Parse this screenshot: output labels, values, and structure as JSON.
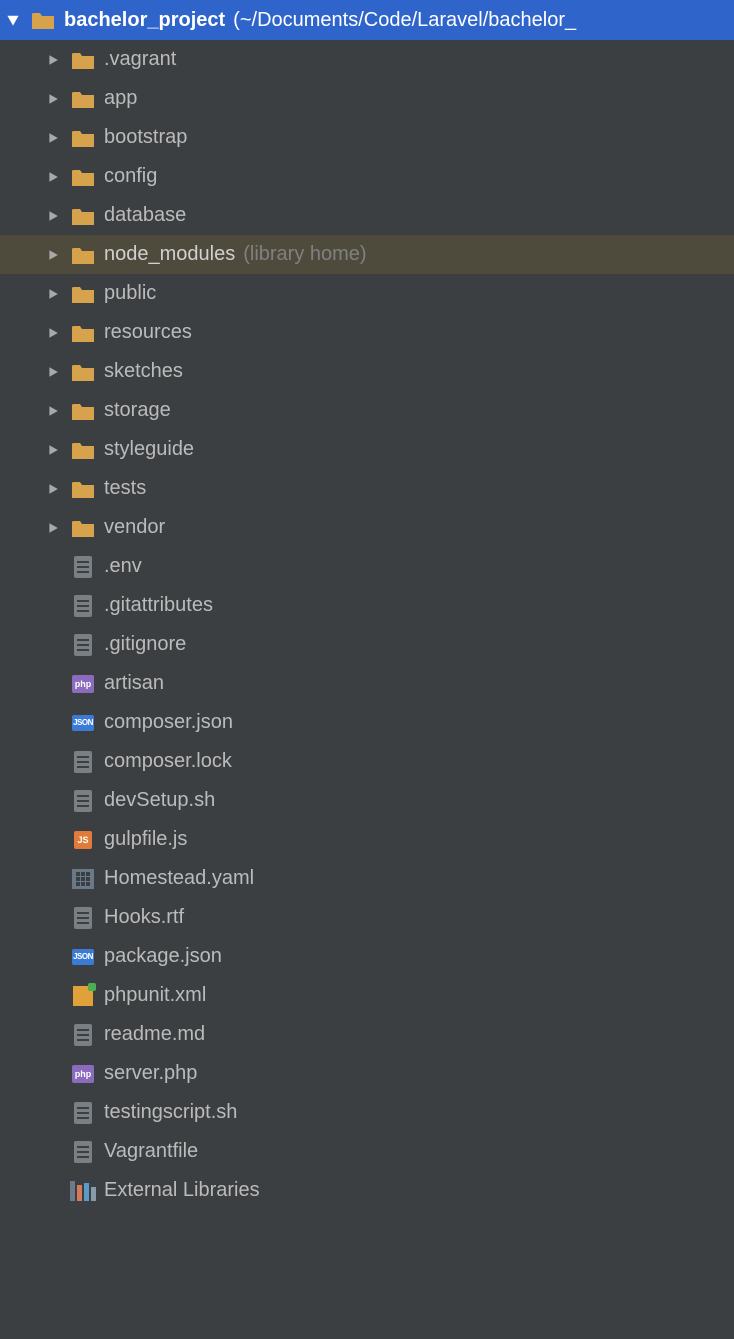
{
  "root": {
    "name": "bachelor_project",
    "path": "(~/Documents/Code/Laravel/bachelor_"
  },
  "items": [
    {
      "type": "folder",
      "name": ".vagrant"
    },
    {
      "type": "folder",
      "name": "app"
    },
    {
      "type": "folder",
      "name": "bootstrap"
    },
    {
      "type": "folder",
      "name": "config"
    },
    {
      "type": "folder",
      "name": "database"
    },
    {
      "type": "folder",
      "name": "node_modules",
      "note": "(library home)",
      "highlighted": true
    },
    {
      "type": "folder",
      "name": "public"
    },
    {
      "type": "folder",
      "name": "resources"
    },
    {
      "type": "folder",
      "name": "sketches"
    },
    {
      "type": "folder",
      "name": "storage"
    },
    {
      "type": "folder",
      "name": "styleguide"
    },
    {
      "type": "folder",
      "name": "tests"
    },
    {
      "type": "folder",
      "name": "vendor"
    },
    {
      "type": "file",
      "icon": "generic",
      "name": ".env"
    },
    {
      "type": "file",
      "icon": "generic",
      "name": ".gitattributes"
    },
    {
      "type": "file",
      "icon": "generic",
      "name": ".gitignore"
    },
    {
      "type": "file",
      "icon": "php",
      "name": "artisan"
    },
    {
      "type": "file",
      "icon": "json",
      "name": "composer.json"
    },
    {
      "type": "file",
      "icon": "generic",
      "name": "composer.lock"
    },
    {
      "type": "file",
      "icon": "generic",
      "name": "devSetup.sh"
    },
    {
      "type": "file",
      "icon": "js",
      "name": "gulpfile.js"
    },
    {
      "type": "file",
      "icon": "yaml",
      "name": "Homestead.yaml"
    },
    {
      "type": "file",
      "icon": "generic",
      "name": "Hooks.rtf"
    },
    {
      "type": "file",
      "icon": "json",
      "name": "package.json"
    },
    {
      "type": "file",
      "icon": "xml",
      "name": "phpunit.xml"
    },
    {
      "type": "file",
      "icon": "generic",
      "name": "readme.md"
    },
    {
      "type": "file",
      "icon": "php",
      "name": "server.php"
    },
    {
      "type": "file",
      "icon": "generic",
      "name": "testingscript.sh"
    },
    {
      "type": "file",
      "icon": "generic",
      "name": "Vagrantfile"
    }
  ],
  "external_libs_label": "External Libraries"
}
